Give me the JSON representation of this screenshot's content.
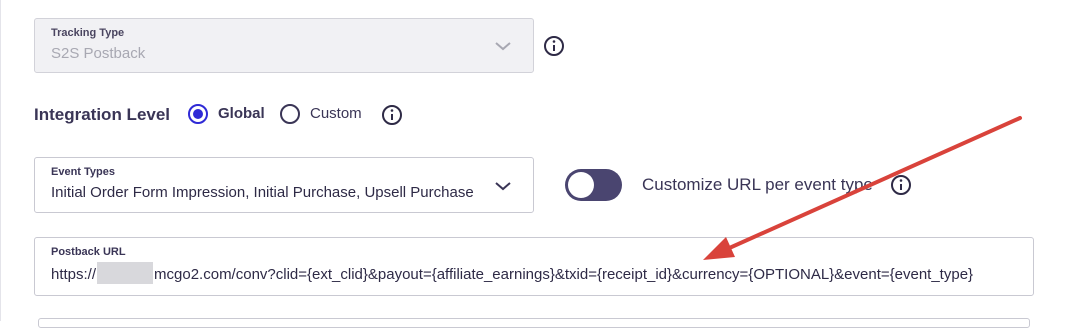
{
  "tracking": {
    "label": "Tracking Type",
    "value": "S2S Postback",
    "icon": "chevron-down-icon",
    "info_icon": "info-icon"
  },
  "integration": {
    "label": "Integration Level",
    "options": [
      {
        "label": "Global",
        "selected": true
      },
      {
        "label": "Custom",
        "selected": false
      }
    ],
    "info_icon": "info-icon"
  },
  "event_types": {
    "label": "Event Types",
    "value": "Initial Order Form Impression, Initial Purchase, Upsell Purchase",
    "icon": "chevron-down-icon"
  },
  "customize": {
    "label": "Customize URL per event type",
    "enabled": false,
    "info_icon": "info-icon"
  },
  "postback": {
    "label": "Postback URL",
    "value_prefix": "https://",
    "value_suffix": "mcgo2.com/conv?clid={ext_clid}&payout={affiliate_earnings}&txid={receipt_id}&currency={OPTIONAL}&event={event_type}"
  },
  "colors": {
    "accent": "#2f2ad6",
    "text": "#3a3556",
    "toggle_off": "#4a4570",
    "annotation_arrow": "#d9433b",
    "disabled_bg": "#f1f1f4"
  }
}
